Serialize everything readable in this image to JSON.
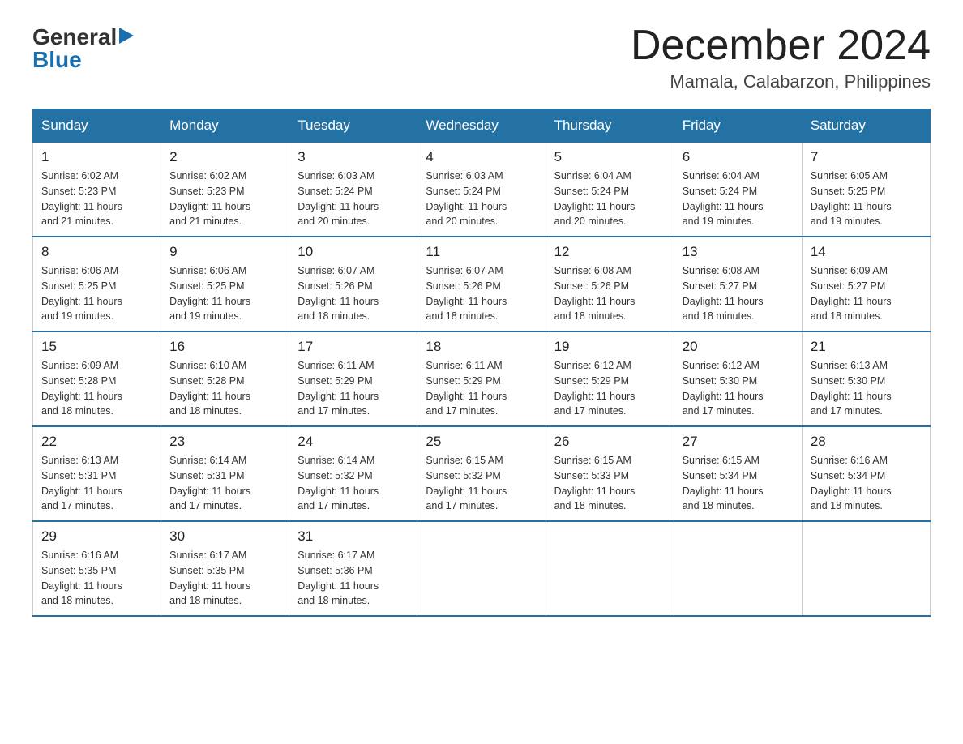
{
  "header": {
    "logo_general": "General",
    "logo_blue": "Blue",
    "month_title": "December 2024",
    "location": "Mamala, Calabarzon, Philippines"
  },
  "days_of_week": [
    "Sunday",
    "Monday",
    "Tuesday",
    "Wednesday",
    "Thursday",
    "Friday",
    "Saturday"
  ],
  "weeks": [
    [
      {
        "day": "1",
        "sunrise": "6:02 AM",
        "sunset": "5:23 PM",
        "daylight": "11 hours and 21 minutes."
      },
      {
        "day": "2",
        "sunrise": "6:02 AM",
        "sunset": "5:23 PM",
        "daylight": "11 hours and 21 minutes."
      },
      {
        "day": "3",
        "sunrise": "6:03 AM",
        "sunset": "5:24 PM",
        "daylight": "11 hours and 20 minutes."
      },
      {
        "day": "4",
        "sunrise": "6:03 AM",
        "sunset": "5:24 PM",
        "daylight": "11 hours and 20 minutes."
      },
      {
        "day": "5",
        "sunrise": "6:04 AM",
        "sunset": "5:24 PM",
        "daylight": "11 hours and 20 minutes."
      },
      {
        "day": "6",
        "sunrise": "6:04 AM",
        "sunset": "5:24 PM",
        "daylight": "11 hours and 19 minutes."
      },
      {
        "day": "7",
        "sunrise": "6:05 AM",
        "sunset": "5:25 PM",
        "daylight": "11 hours and 19 minutes."
      }
    ],
    [
      {
        "day": "8",
        "sunrise": "6:06 AM",
        "sunset": "5:25 PM",
        "daylight": "11 hours and 19 minutes."
      },
      {
        "day": "9",
        "sunrise": "6:06 AM",
        "sunset": "5:25 PM",
        "daylight": "11 hours and 19 minutes."
      },
      {
        "day": "10",
        "sunrise": "6:07 AM",
        "sunset": "5:26 PM",
        "daylight": "11 hours and 18 minutes."
      },
      {
        "day": "11",
        "sunrise": "6:07 AM",
        "sunset": "5:26 PM",
        "daylight": "11 hours and 18 minutes."
      },
      {
        "day": "12",
        "sunrise": "6:08 AM",
        "sunset": "5:26 PM",
        "daylight": "11 hours and 18 minutes."
      },
      {
        "day": "13",
        "sunrise": "6:08 AM",
        "sunset": "5:27 PM",
        "daylight": "11 hours and 18 minutes."
      },
      {
        "day": "14",
        "sunrise": "6:09 AM",
        "sunset": "5:27 PM",
        "daylight": "11 hours and 18 minutes."
      }
    ],
    [
      {
        "day": "15",
        "sunrise": "6:09 AM",
        "sunset": "5:28 PM",
        "daylight": "11 hours and 18 minutes."
      },
      {
        "day": "16",
        "sunrise": "6:10 AM",
        "sunset": "5:28 PM",
        "daylight": "11 hours and 18 minutes."
      },
      {
        "day": "17",
        "sunrise": "6:11 AM",
        "sunset": "5:29 PM",
        "daylight": "11 hours and 17 minutes."
      },
      {
        "day": "18",
        "sunrise": "6:11 AM",
        "sunset": "5:29 PM",
        "daylight": "11 hours and 17 minutes."
      },
      {
        "day": "19",
        "sunrise": "6:12 AM",
        "sunset": "5:29 PM",
        "daylight": "11 hours and 17 minutes."
      },
      {
        "day": "20",
        "sunrise": "6:12 AM",
        "sunset": "5:30 PM",
        "daylight": "11 hours and 17 minutes."
      },
      {
        "day": "21",
        "sunrise": "6:13 AM",
        "sunset": "5:30 PM",
        "daylight": "11 hours and 17 minutes."
      }
    ],
    [
      {
        "day": "22",
        "sunrise": "6:13 AM",
        "sunset": "5:31 PM",
        "daylight": "11 hours and 17 minutes."
      },
      {
        "day": "23",
        "sunrise": "6:14 AM",
        "sunset": "5:31 PM",
        "daylight": "11 hours and 17 minutes."
      },
      {
        "day": "24",
        "sunrise": "6:14 AM",
        "sunset": "5:32 PM",
        "daylight": "11 hours and 17 minutes."
      },
      {
        "day": "25",
        "sunrise": "6:15 AM",
        "sunset": "5:32 PM",
        "daylight": "11 hours and 17 minutes."
      },
      {
        "day": "26",
        "sunrise": "6:15 AM",
        "sunset": "5:33 PM",
        "daylight": "11 hours and 18 minutes."
      },
      {
        "day": "27",
        "sunrise": "6:15 AM",
        "sunset": "5:34 PM",
        "daylight": "11 hours and 18 minutes."
      },
      {
        "day": "28",
        "sunrise": "6:16 AM",
        "sunset": "5:34 PM",
        "daylight": "11 hours and 18 minutes."
      }
    ],
    [
      {
        "day": "29",
        "sunrise": "6:16 AM",
        "sunset": "5:35 PM",
        "daylight": "11 hours and 18 minutes."
      },
      {
        "day": "30",
        "sunrise": "6:17 AM",
        "sunset": "5:35 PM",
        "daylight": "11 hours and 18 minutes."
      },
      {
        "day": "31",
        "sunrise": "6:17 AM",
        "sunset": "5:36 PM",
        "daylight": "11 hours and 18 minutes."
      },
      null,
      null,
      null,
      null
    ]
  ],
  "labels": {
    "sunrise_prefix": "Sunrise: ",
    "sunset_prefix": "Sunset: ",
    "daylight_prefix": "Daylight: "
  }
}
